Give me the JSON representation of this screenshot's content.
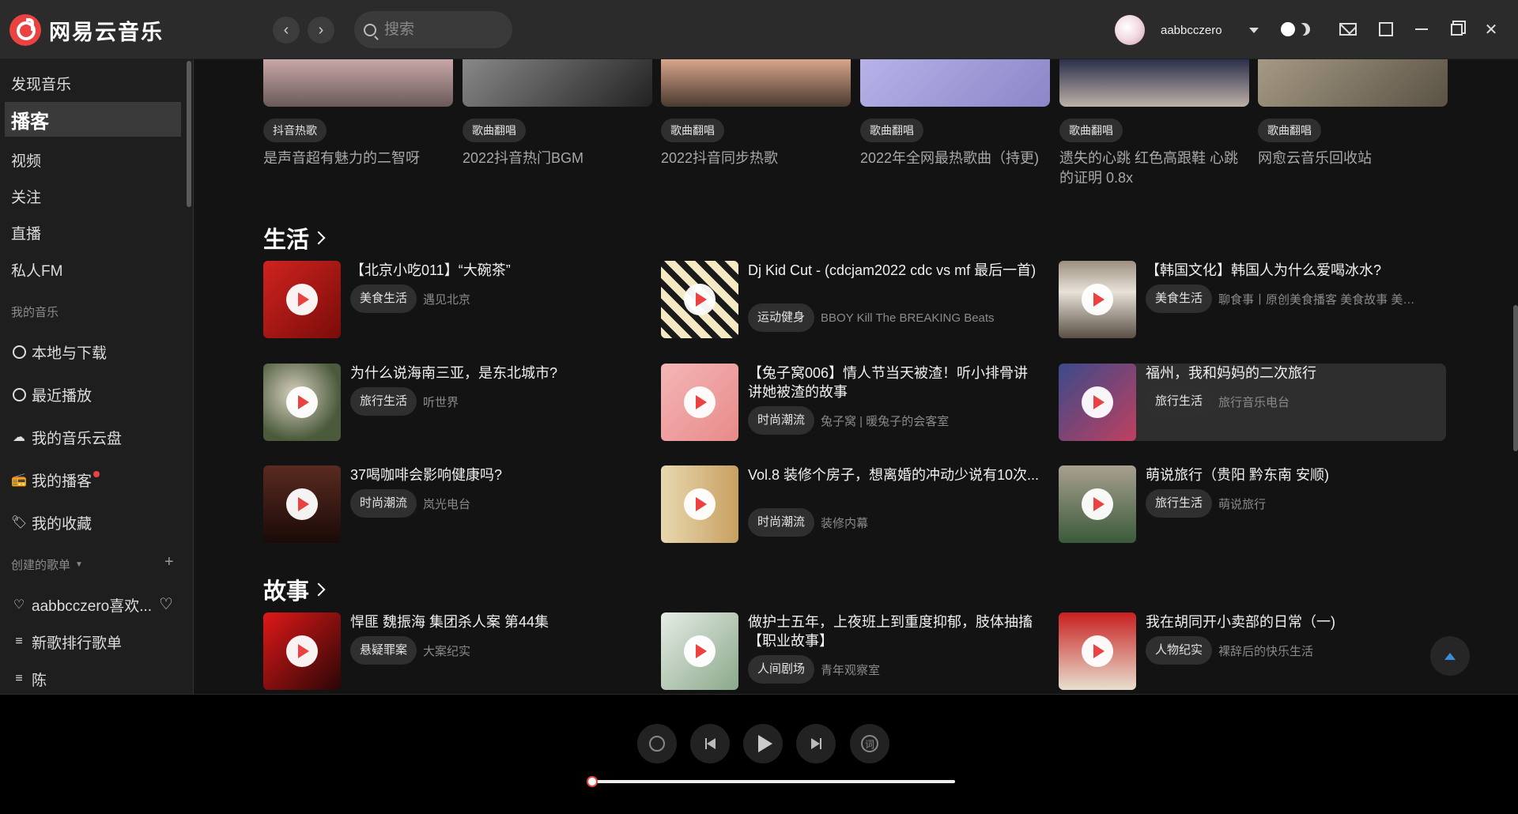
{
  "app": {
    "name": "网易云音乐",
    "accent": "#ec4141"
  },
  "search": {
    "placeholder": "搜索"
  },
  "user": {
    "name": "aabbcczero"
  },
  "sidebar": {
    "items": [
      {
        "label": "发现音乐"
      },
      {
        "label": "播客",
        "active": true
      },
      {
        "label": "视频"
      },
      {
        "label": "关注"
      },
      {
        "label": "直播"
      },
      {
        "label": "私人FM"
      }
    ],
    "my_music_title": "我的音乐",
    "my_music": [
      {
        "label": "本地与下载",
        "icon": "download-icon"
      },
      {
        "label": "最近播放",
        "icon": "clock-icon"
      },
      {
        "label": "我的音乐云盘",
        "icon": "cloud-icon"
      },
      {
        "label": "我的播客",
        "icon": "radio-icon"
      },
      {
        "label": "我的收藏",
        "icon": "tag-icon"
      }
    ],
    "created_title": "创建的歌单",
    "playlists": [
      {
        "label": "aabbcczero喜欢...",
        "icon": "heart-icon"
      },
      {
        "label": "新歌排行歌单",
        "icon": "playlist-icon"
      },
      {
        "label": "陈",
        "icon": "playlist-icon"
      }
    ]
  },
  "top_cards": [
    {
      "tag": "抖音热歌",
      "title": "是声音超有魅力的二智呀"
    },
    {
      "tag": "歌曲翻唱",
      "title": "2022抖音热门BGM"
    },
    {
      "tag": "歌曲翻唱",
      "title": "2022抖音同步热歌"
    },
    {
      "tag": "歌曲翻唱",
      "title": "2022年全网最热歌曲（持更)"
    },
    {
      "tag": "歌曲翻唱",
      "title": "遗失的心跳 红色高跟鞋 心跳的证明 0.8x"
    },
    {
      "tag": "歌曲翻唱",
      "title": "网愈云音乐回收站"
    }
  ],
  "sections": [
    {
      "title": "生活",
      "items": [
        {
          "title": "【北京小吃011】“大碗茶”",
          "tag": "美食生活",
          "meta": "遇见北京"
        },
        {
          "title": "Dj Kid Cut - (cdcjam2022 cdc vs mf 最后一首)",
          "tag": "运动健身",
          "meta": "BBOY Kill The BREAKING Beats"
        },
        {
          "title": "【韩国文化】韩国人为什么爱喝冰水?",
          "tag": "美食生活",
          "meta": "聊食事丨原创美食播客 美食故事 美食..."
        },
        {
          "title": "为什么说海南三亚，是东北城市?",
          "tag": "旅行生活",
          "meta": "听世界"
        },
        {
          "title": "【兔子窝006】情人节当天被渣！听小排骨讲讲她被渣的故事",
          "tag": "时尚潮流",
          "meta": "兔子窝 | 暖兔子的会客室"
        },
        {
          "title": "福州，我和妈妈的二次旅行",
          "tag": "旅行生活",
          "meta": "旅行音乐电台"
        },
        {
          "title": "37喝咖啡会影响健康吗?",
          "tag": "时尚潮流",
          "meta": "岚光电台"
        },
        {
          "title": "Vol.8 装修个房子，想离婚的冲动少说有10次...",
          "tag": "时尚潮流",
          "meta": "装修内幕"
        },
        {
          "title": "萌说旅行（贵阳 黔东南 安顺)",
          "tag": "旅行生活",
          "meta": "萌说旅行"
        }
      ]
    },
    {
      "title": "故事",
      "items": [
        {
          "title": "悍匪 魏振海 集团杀人案 第44集",
          "tag": "悬疑罪案",
          "meta": "大案纪实"
        },
        {
          "title": "做护士五年，上夜班上到重度抑郁，肢体抽搐【职业故事】",
          "tag": "人间剧场",
          "meta": "青年观察室"
        },
        {
          "title": "我在胡同开小卖部的日常（一)",
          "tag": "人物纪实",
          "meta": "裸辞后的快乐生活"
        }
      ]
    }
  ],
  "player": {
    "progress": 0,
    "lyric_label": "词"
  }
}
